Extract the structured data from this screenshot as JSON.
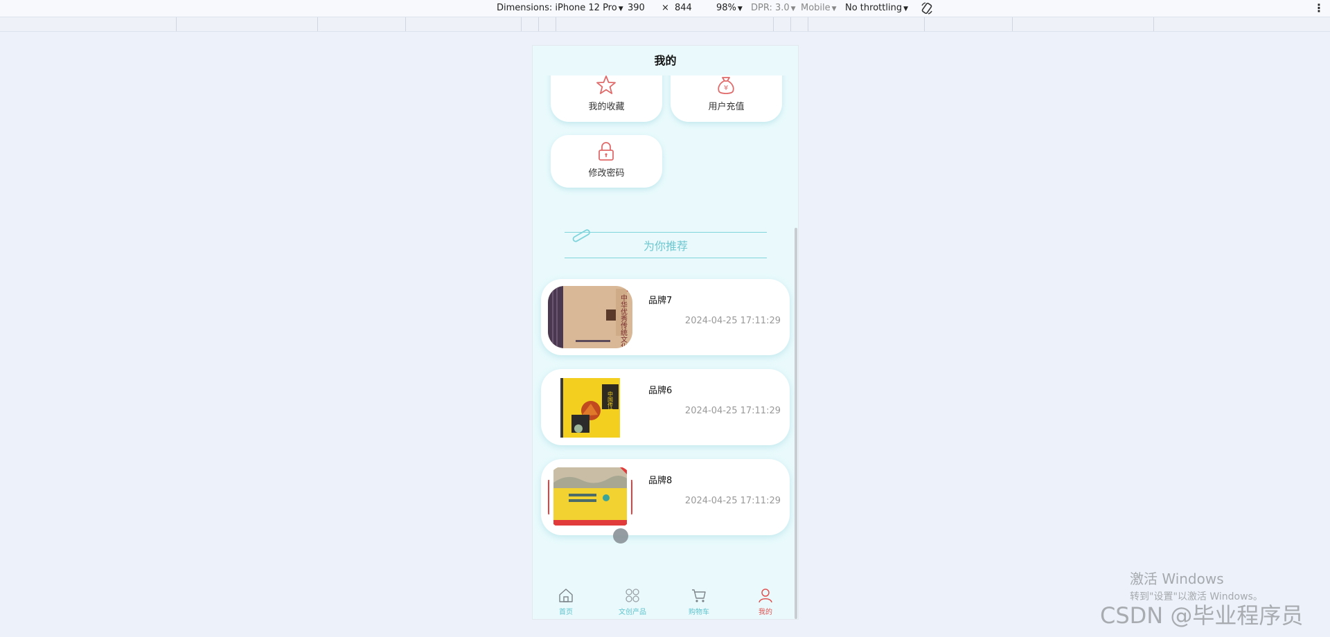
{
  "devtools": {
    "dimensions_label": "Dimensions: iPhone 12 Pro",
    "width": "390",
    "times": "×",
    "height": "844",
    "zoom": "98%",
    "dpr": "DPR: 3.0",
    "mobile": "Mobile",
    "throttling": "No throttling"
  },
  "page": {
    "title": "我的"
  },
  "menu": {
    "favorites": "我的收藏",
    "recharge": "用户充值",
    "change_password": "修改密码"
  },
  "recommend": {
    "title": "为你推荐"
  },
  "products": [
    {
      "name": "品牌7",
      "time": "2024-04-25 17:11:29"
    },
    {
      "name": "品牌6",
      "time": "2024-04-25 17:11:29"
    },
    {
      "name": "品牌8",
      "time": "2024-04-25 17:11:29"
    }
  ],
  "tabbar": {
    "home": "首页",
    "products": "文创产品",
    "cart": "购物车",
    "mine": "我的"
  },
  "colors": {
    "accent": "#5fc3cd",
    "icon_red": "#e06a6a",
    "active_tab": "#e05252",
    "phone_bg": "#eafafc"
  },
  "watermarks": {
    "windows_line1": "激活 Windows",
    "windows_line2": "转到\"设置\"以激活 Windows。",
    "csdn": "CSDN @毕业程序员"
  }
}
